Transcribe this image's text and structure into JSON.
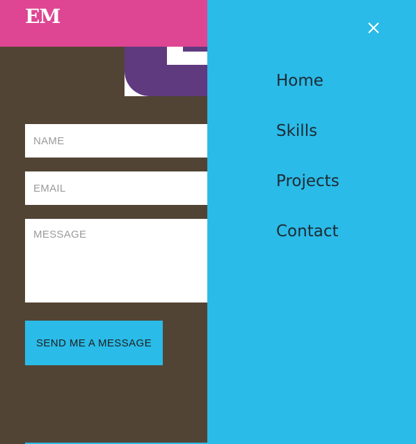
{
  "header": {
    "logo_text": "EM"
  },
  "contact_form": {
    "name_placeholder": "NAME",
    "email_placeholder": "EMAIL",
    "message_placeholder": "MESSAGE",
    "submit_label": "SEND ME A MESSAGE"
  },
  "side_menu": {
    "close_icon": "close-icon",
    "items": [
      {
        "label": "Home"
      },
      {
        "label": "Skills"
      },
      {
        "label": "Projects"
      },
      {
        "label": "Contact"
      }
    ]
  },
  "colors": {
    "header_bg": "#DE4592",
    "page_bg": "#524434",
    "accent": "#2ABBE8",
    "deco_purple": "#5F3A7F",
    "nav_text": "#1E2A33"
  }
}
